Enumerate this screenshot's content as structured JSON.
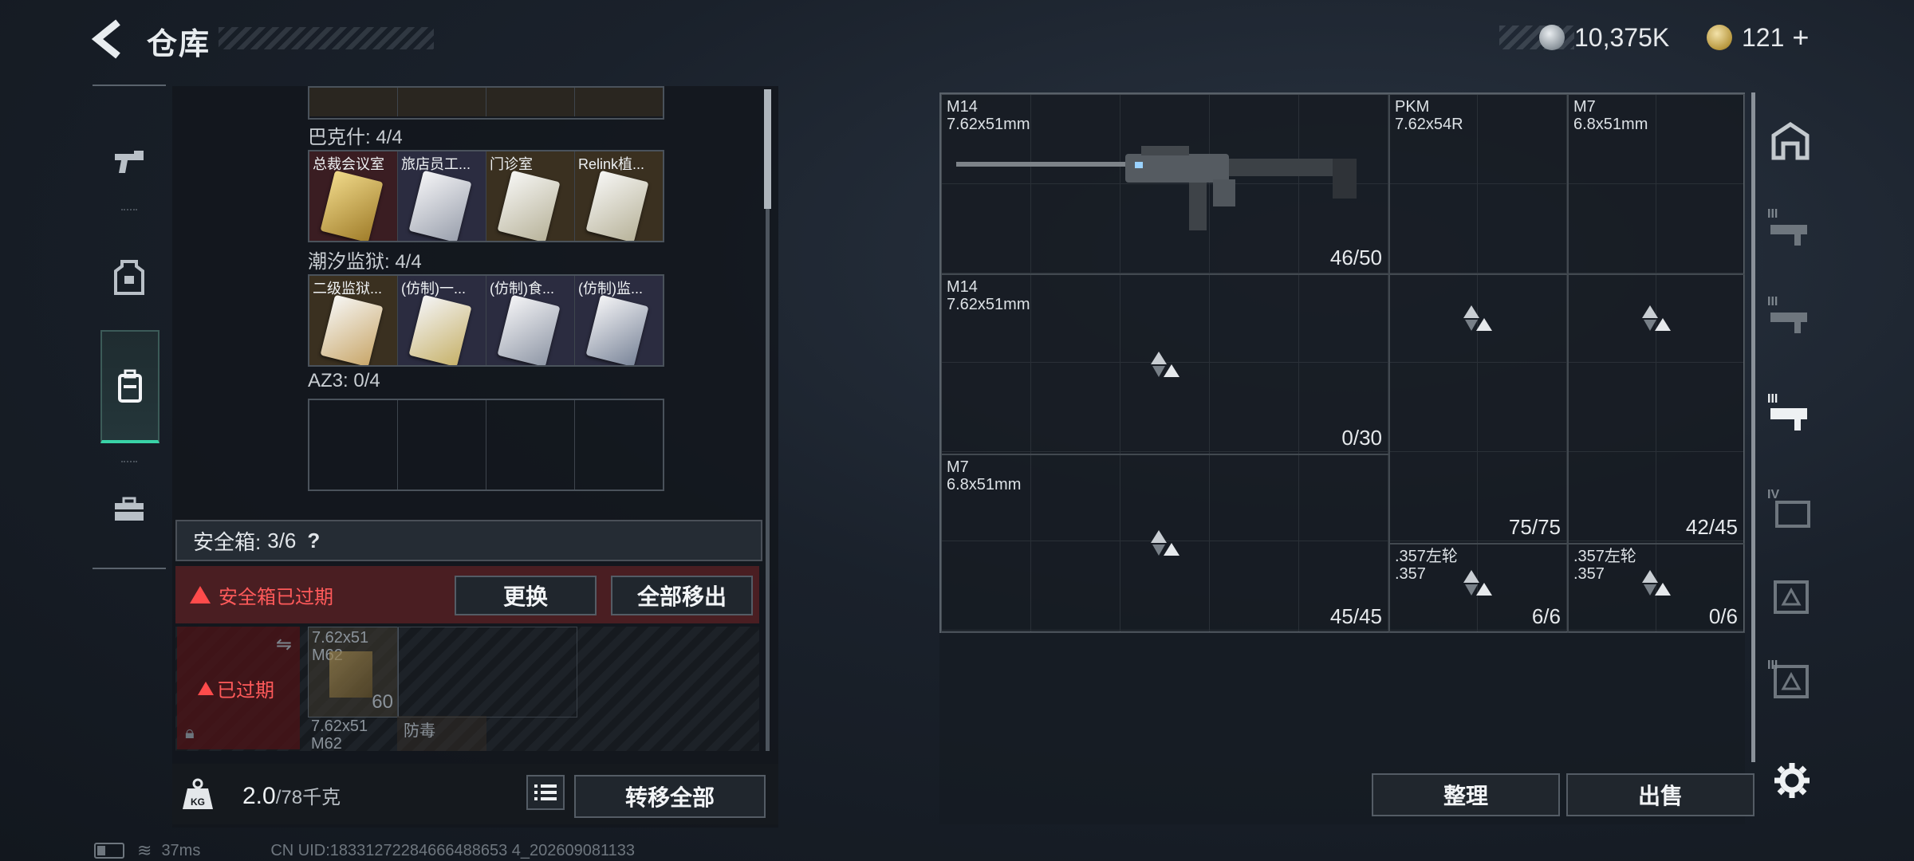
{
  "header": {
    "title": "仓库",
    "currency1": "10,375K",
    "currency2": "121",
    "add_symbol": "+"
  },
  "left_nav": {
    "items": [
      {
        "name": "weapons-tab"
      },
      {
        "name": "gear-tab"
      },
      {
        "name": "backpack-tab"
      },
      {
        "name": "toolbox-tab"
      }
    ]
  },
  "keycards": {
    "groups": [
      {
        "label": "巴克什: 4/4",
        "cards": [
          "总裁会议室",
          "旅店员工...",
          "门诊室",
          "Relink植..."
        ]
      },
      {
        "label": "潮汐监狱: 4/4",
        "cards": [
          "二级监狱...",
          "(仿制)一...",
          "(仿制)食...",
          "(仿制)监..."
        ]
      },
      {
        "label": "AZ3: 0/4",
        "cards": [
          "",
          "",
          "",
          ""
        ]
      }
    ]
  },
  "safebox": {
    "label": "安全箱:",
    "count": "3/6",
    "help": "?",
    "expired_warning": "安全箱已过期",
    "replace_button": "更换",
    "move_all_button": "全部移出",
    "expired_tag": "已过期",
    "item1_name": "7.62x51",
    "item1_sub": "M62",
    "item1_count": "60",
    "item2_name": "7.62x51",
    "item2_sub": "M62",
    "item3_name": "防毒"
  },
  "bottom_bar": {
    "weight_value": "2.0",
    "weight_max": "/78千克",
    "transfer_all_button": "转移全部"
  },
  "status": {
    "ping": "37ms",
    "uid": "CN UID:18331272284666488653 4_202609081133"
  },
  "storage": {
    "cells": [
      {
        "name": "M14",
        "sub": "7.62x51mm",
        "count": "46/50"
      },
      {
        "name": "PKM",
        "sub": "7.62x54R",
        "count": ""
      },
      {
        "name": "M7",
        "sub": "6.8x51mm",
        "count": ""
      },
      {
        "name": "M14",
        "sub": "7.62x51mm",
        "count": "0/30"
      },
      {
        "name": "",
        "sub": "",
        "count": ""
      },
      {
        "name": "",
        "sub": "",
        "count": ""
      },
      {
        "name": "M7",
        "sub": "6.8x51mm",
        "count": "45/45"
      },
      {
        "name": "",
        "sub": "",
        "count": "75/75"
      },
      {
        "name": "",
        "sub": "",
        "count": "42/45"
      },
      {
        "name": ".357左轮",
        "sub": ".357",
        "count": "6/6"
      },
      {
        "name": ".357左轮",
        "sub": ".357",
        "count": "0/6"
      }
    ],
    "organize_button": "整理",
    "sell_button": "出售"
  },
  "right_nav": {
    "labels": [
      "",
      "III",
      "III",
      "III",
      "IV",
      "",
      "III"
    ]
  }
}
